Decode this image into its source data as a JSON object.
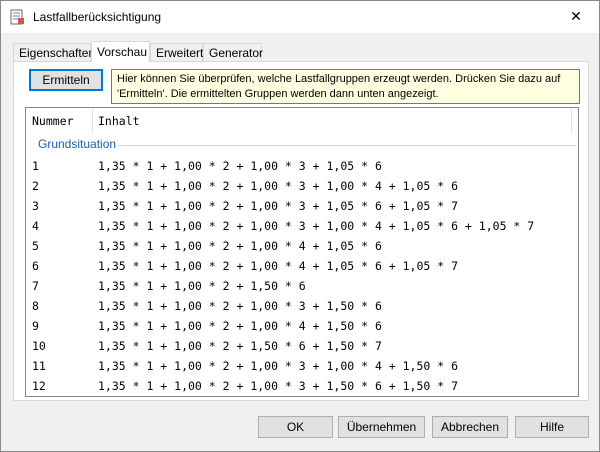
{
  "window": {
    "title": "Lastfallberücksichtigung",
    "close_symbol": "✕"
  },
  "tabs": [
    {
      "label": "Eigenschaften"
    },
    {
      "label": "Vorschau"
    },
    {
      "label": "Erweitert"
    },
    {
      "label": "Generator"
    }
  ],
  "preview": {
    "ermitteln_label": "Ermitteln",
    "hint_line1": "Hier können Sie überprüfen, welche Lastfallgruppen erzeugt werden. Drücken Sie dazu auf",
    "hint_line2": "'Ermitteln'. Die ermittelten Gruppen werden dann unten angezeigt."
  },
  "list": {
    "columns": [
      "Nummer",
      "Inhalt"
    ],
    "group": "Grundsituation",
    "rows": [
      {
        "num": "1",
        "content": "1,35 * 1 + 1,00 * 2 + 1,00 * 3 + 1,05 * 6"
      },
      {
        "num": "2",
        "content": "1,35 * 1 + 1,00 * 2 + 1,00 * 3 + 1,00 * 4 + 1,05 * 6"
      },
      {
        "num": "3",
        "content": "1,35 * 1 + 1,00 * 2 + 1,00 * 3 + 1,05 * 6 + 1,05 * 7"
      },
      {
        "num": "4",
        "content": "1,35 * 1 + 1,00 * 2 + 1,00 * 3 + 1,00 * 4 + 1,05 * 6 + 1,05 * 7"
      },
      {
        "num": "5",
        "content": "1,35 * 1 + 1,00 * 2 + 1,00 * 4 + 1,05 * 6"
      },
      {
        "num": "6",
        "content": "1,35 * 1 + 1,00 * 2 + 1,00 * 4 + 1,05 * 6 + 1,05 * 7"
      },
      {
        "num": "7",
        "content": "1,35 * 1 + 1,00 * 2 + 1,50 * 6"
      },
      {
        "num": "8",
        "content": "1,35 * 1 + 1,00 * 2 + 1,00 * 3 + 1,50 * 6"
      },
      {
        "num": "9",
        "content": "1,35 * 1 + 1,00 * 2 + 1,00 * 4 + 1,50 * 6"
      },
      {
        "num": "10",
        "content": "1,35 * 1 + 1,00 * 2 + 1,50 * 6 + 1,50 * 7"
      },
      {
        "num": "11",
        "content": "1,35 * 1 + 1,00 * 2 + 1,00 * 3 + 1,00 * 4 + 1,50 * 6"
      },
      {
        "num": "12",
        "content": "1,35 * 1 + 1,00 * 2 + 1,00 * 3 + 1,50 * 6 + 1,50 * 7"
      }
    ]
  },
  "footer": {
    "ok": "OK",
    "apply": "Übernehmen",
    "cancel": "Abbrechen",
    "help": "Hilfe"
  }
}
